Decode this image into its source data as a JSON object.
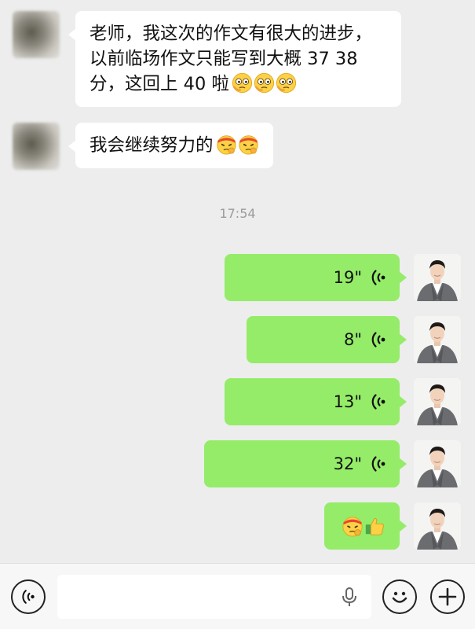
{
  "incoming": [
    {
      "lines": [
        "老师，我这次的作文有很大的进步，",
        "以前临场作文只能写到大概 37 38",
        "分，这回上 40 啦"
      ],
      "emojis": [
        "awkward-face-icon",
        "awkward-face-icon",
        "awkward-face-icon"
      ]
    },
    {
      "lines": [
        "我会继续努力的"
      ],
      "emojis": [
        "determined-face-icon",
        "determined-face-icon"
      ]
    }
  ],
  "timestamp": "17:54",
  "outgoing_voice": [
    {
      "duration": "19\""
    },
    {
      "duration": "8\""
    },
    {
      "duration": "13\""
    },
    {
      "duration": "32\""
    }
  ],
  "outgoing_sticker": {
    "emojis": [
      "determined-face-icon",
      "thumbs-up-icon"
    ]
  },
  "input_bar": {
    "left_icon": "voice-mode-icon",
    "mic_icon": "microphone-icon",
    "emoji_icon": "smiley-face-icon",
    "more_icon": "plus-icon"
  },
  "colors": {
    "background": "#ededed",
    "incoming_bubble": "#ffffff",
    "outgoing_bubble": "#95ec69",
    "timestamp": "#9b9b9b"
  }
}
